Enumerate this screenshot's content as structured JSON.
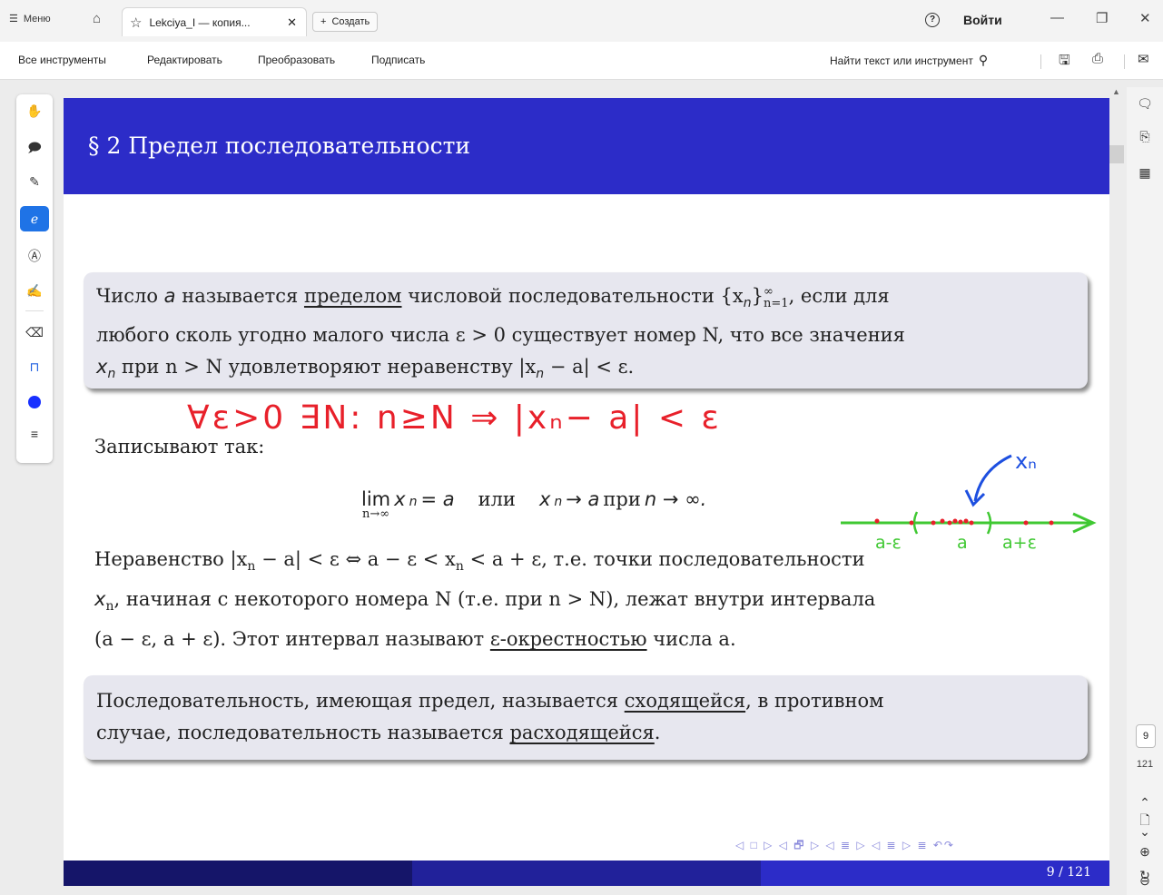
{
  "titlebar": {
    "menu_label": "Меню",
    "tab_title": "Lekciya_I — копия...",
    "new_label": "Создать",
    "login_label": "Войти"
  },
  "toolbar": {
    "all_tools": "Все инструменты",
    "edit": "Редактировать",
    "convert": "Преобразовать",
    "sign": "Подписать",
    "search_placeholder": "Найти текст или инструмент"
  },
  "left_tools": [
    "hand-icon",
    "comment-icon",
    "pen-icon",
    "lasso-icon",
    "text-select-icon",
    "stamp-icon",
    "eraser-icon",
    "pin-icon",
    "color-dot",
    "menu-lines-icon"
  ],
  "right_panel": {
    "current_page": "9",
    "total_pages": "121"
  },
  "slide": {
    "title": "§ 2 Предел последовательности",
    "definition": {
      "p1": "Число ",
      "a": "a",
      "p2": " называется ",
      "term": "пределом",
      "p3": " числовой последовательности {x",
      "sub_n": "n",
      "p4": "}",
      "sup_inf": "∞",
      "sub_n1": "n=1",
      "p5": ", если для",
      "line2": "любого сколь угодно малого числа ε > 0 существует номер N, что все значения",
      "line3": "x",
      "line3_sub": "n",
      "line3_rest": " при n > N удовлетворяют неравенству |x",
      "line3_sub2": "n",
      "line3_end": " − a| < ε."
    },
    "written_label": "Записывают так:",
    "formula": {
      "lim": "lim",
      "lim_sub": "n→∞",
      "expr1": "x",
      "expr1_sub": "n",
      "expr1_rest": " = a",
      "ili": "или",
      "expr2": "x",
      "expr2_sub": "n",
      "expr2_rest": " → a",
      "pri": "при",
      "expr3": "n → ∞."
    },
    "inequality": {
      "line1": "Неравенство |x",
      "l1_sub": "n",
      "l1_rest": " − a| < ε  ⇔  a − ε < x",
      "l1_sub2": "n",
      "l1_end": " < a + ε, т.е. точки последовательности",
      "line2": "x",
      "l2_sub": "n",
      "l2_rest": ", начиная с некоторого номера N (т.е. при n > N), лежат внутри интервала",
      "line3": "(a − ε, a + ε). Этот интервал называют ",
      "l3_term": "ε-окрестностью",
      "l3_end": " числа a."
    },
    "convergence": {
      "p1": "Последовательность, имеющая предел, называется ",
      "term1": "сходящейся",
      "p2": ", в противном",
      "p3": "случае, последовательность называется ",
      "term2": "расходящейся",
      "p4": "."
    },
    "nav_symbols": "◁ □ ▷ ◁ 🗗 ▷ ◁ ≣ ▷ ◁ ≣ ▷   ≣   ↶↷",
    "footer_page": "9 / 121"
  },
  "handwriting": {
    "red_text": "∀ε>0 ∃N: n≥N ⇒ |xₙ− a| < ε",
    "xn_label": "xₙ",
    "axis_labels": [
      "a-ε",
      "a",
      "a+ε"
    ],
    "colors": {
      "red": "#e8202a",
      "green": "#3fc832",
      "blue": "#1d4fe0"
    }
  },
  "colors": {
    "slide_header": "#2c2cc8",
    "block_bg": "#e7e7ef",
    "accent": "#1f73e6"
  }
}
